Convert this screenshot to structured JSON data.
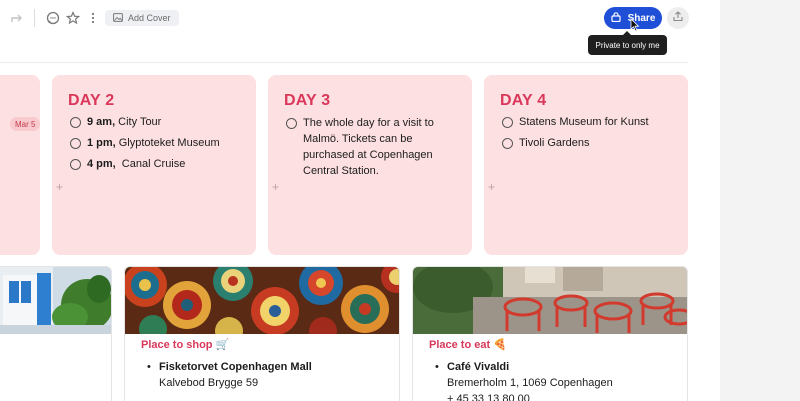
{
  "toolbar": {
    "add_cover_label": "Add Cover",
    "share_label": "Share",
    "share_tooltip": "Private to only me",
    "accent_color": "#1e4fd6"
  },
  "partial_day": {
    "date_chip": "Mar 5"
  },
  "days": [
    {
      "title": "DAY 2",
      "tasks": [
        {
          "time": "9 am,",
          "text": "City Tour"
        },
        {
          "time": "1 pm,",
          "text": "Glyptoteket Museum"
        },
        {
          "time": "4 pm,",
          "text": " Canal Cruise"
        }
      ]
    },
    {
      "title": "DAY 3",
      "tasks": [
        {
          "line1": "The whole day for a visit to",
          "line2": "Malmö. Tickets can be",
          "line3": "purchased at Copenhagen",
          "line4": "Central Station."
        }
      ]
    },
    {
      "title": "DAY 4",
      "tasks": [
        {
          "text": "Statens Museum for Kunst"
        },
        {
          "text": "Tivoli Gardens"
        }
      ]
    }
  ],
  "places": [
    {
      "title": "Place to shop 🛒",
      "items": [
        {
          "name": "Fisketorvet Copenhagen Mall",
          "address": "Kalvebod Brygge 59"
        }
      ]
    },
    {
      "title": "Place to eat 🍕",
      "items": [
        {
          "name": "Café Vivaldi",
          "address": "Bremerholm 1, 1069 Copenhagen",
          "phone": "+ 45 33 13 80 00"
        }
      ]
    }
  ],
  "colors": {
    "day_card_bg": "#fde0e2",
    "day_title": "#d9385a"
  }
}
